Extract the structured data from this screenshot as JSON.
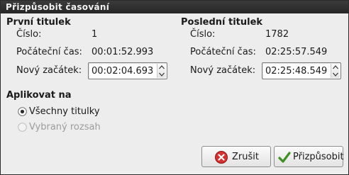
{
  "window": {
    "title": "Přizpůsobit časování"
  },
  "first": {
    "heading": "První titulek",
    "number_label": "Číslo:",
    "number_value": "1",
    "start_label": "Počáteční čas:",
    "start_value": "00:01:52.993",
    "new_start_label": "Nový začátek:",
    "new_start_value": "00:02:04.693"
  },
  "last": {
    "heading": "Poslední titulek",
    "number_label": "Číslo:",
    "number_value": "1782",
    "start_label": "Počáteční čas:",
    "start_value": "02:25:57.549",
    "new_start_label": "Nový začátek:",
    "new_start_value": "02:25:48.549"
  },
  "apply": {
    "heading": "Aplikovat na",
    "options": [
      {
        "label": "Všechny titulky",
        "selected": true,
        "disabled": false
      },
      {
        "label": "Vybraný rozsah",
        "selected": false,
        "disabled": true
      }
    ]
  },
  "buttons": {
    "cancel": {
      "label": "Zrušit",
      "icon": "cancel-icon",
      "color": "#cc2a2a"
    },
    "ok": {
      "label": "Přizpůsobit",
      "icon": "checkmark-icon",
      "color": "#4a9a2a"
    }
  }
}
